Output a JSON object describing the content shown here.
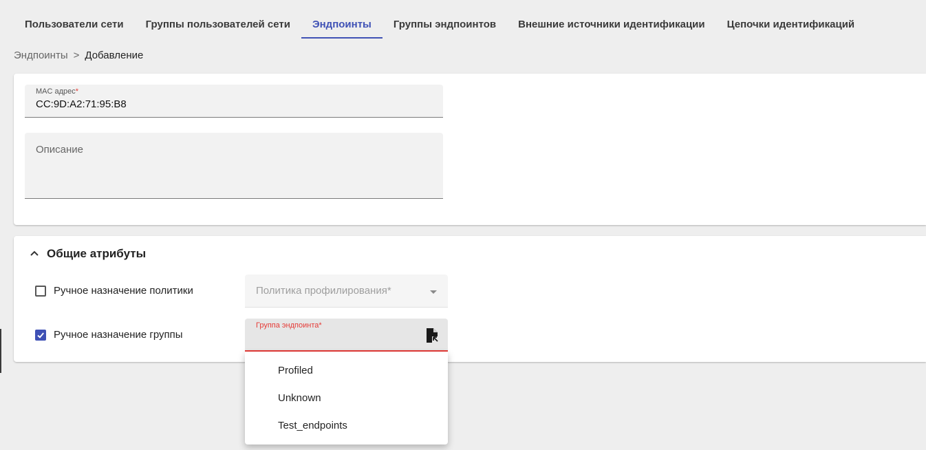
{
  "tabs": [
    {
      "label": "Пользователи сети",
      "active": false
    },
    {
      "label": "Группы пользователей сети",
      "active": false
    },
    {
      "label": "Эндпоинты",
      "active": true
    },
    {
      "label": "Группы эндпоинтов",
      "active": false
    },
    {
      "label": "Внешние источники идентификации",
      "active": false
    },
    {
      "label": "Цепочки идентификаций",
      "active": false
    }
  ],
  "breadcrumb": {
    "parent": "Эндпоинты",
    "separator": ">",
    "current": "Добавление"
  },
  "form": {
    "mac": {
      "label": "MAC адрес",
      "required_mark": "*",
      "value": "CC:9D:A2:71:95:B8"
    },
    "description": {
      "label": "Описание",
      "value": ""
    }
  },
  "attributes": {
    "title": "Общие атрибуты",
    "expanded": true,
    "policy_checkbox": {
      "label": "Ручное назначение политики",
      "checked": false
    },
    "policy_select": {
      "placeholder": "Политика профилирования*"
    },
    "group_checkbox": {
      "label": "Ручное назначение группы",
      "checked": true
    },
    "group_select": {
      "label": "Группа эндпоинта*",
      "value": ""
    }
  },
  "dropdown": {
    "options": [
      "Profiled",
      "Unknown",
      "Test_endpoints"
    ]
  },
  "colors": {
    "accent": "#3f51b5",
    "error": "#e53935",
    "background": "#eeeeee"
  },
  "icons": {
    "accordion": "chevron-up-icon",
    "group_select": "file-cursor-icon",
    "policy_select": "caret-down-icon",
    "checkbox": "checkmark-icon"
  }
}
